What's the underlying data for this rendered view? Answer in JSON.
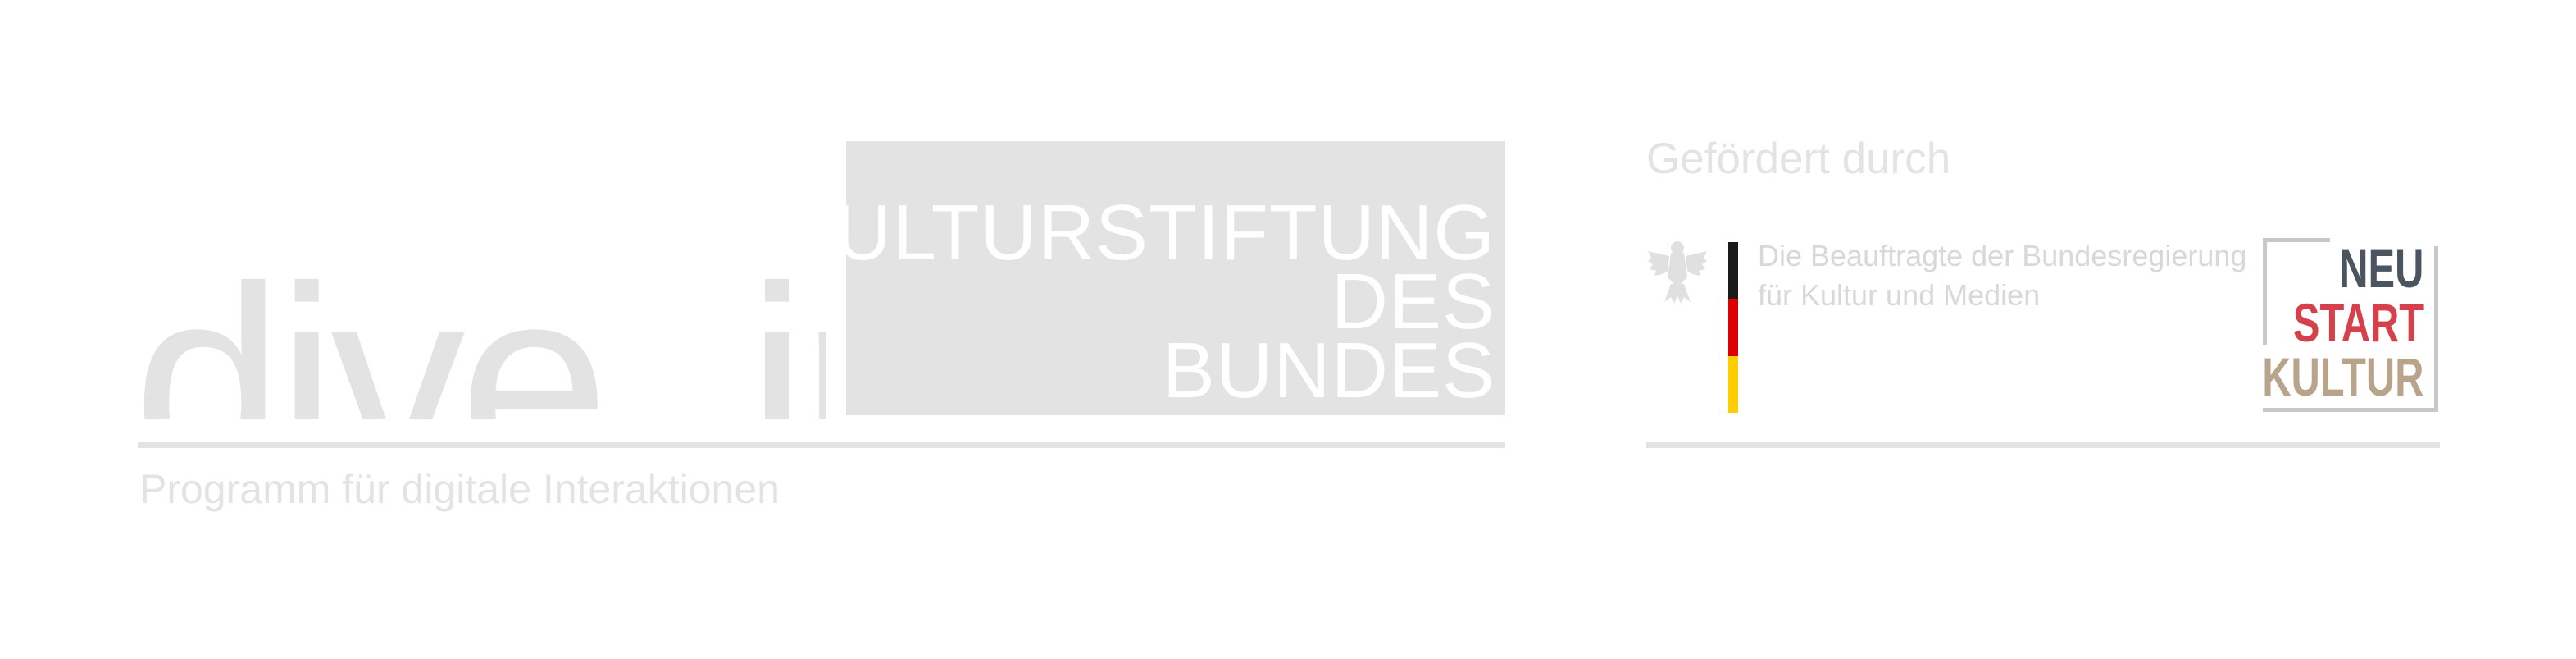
{
  "left": {
    "logo_text": "dive_in",
    "foundation_lines": [
      "KULTURSTIFTUNG",
      "DES",
      "BUNDES"
    ],
    "caption": "Programm für digitale Interaktionen"
  },
  "right": {
    "funded_by": "Gefördert durch",
    "bkm_lines": [
      "Die Beauftragte der Bundesregierung",
      "für Kultur und Medien"
    ],
    "nsk_words": [
      "NEU",
      "START",
      "KULTUR"
    ],
    "nsk_colors": [
      "#4a5560",
      "#d5404a",
      "#b8a38b"
    ],
    "flag_colors": [
      "#1a1a1a",
      "#dd0000",
      "#ffce00"
    ]
  },
  "colors": {
    "light_gray": "#e3e3e3",
    "white": "#ffffff"
  }
}
